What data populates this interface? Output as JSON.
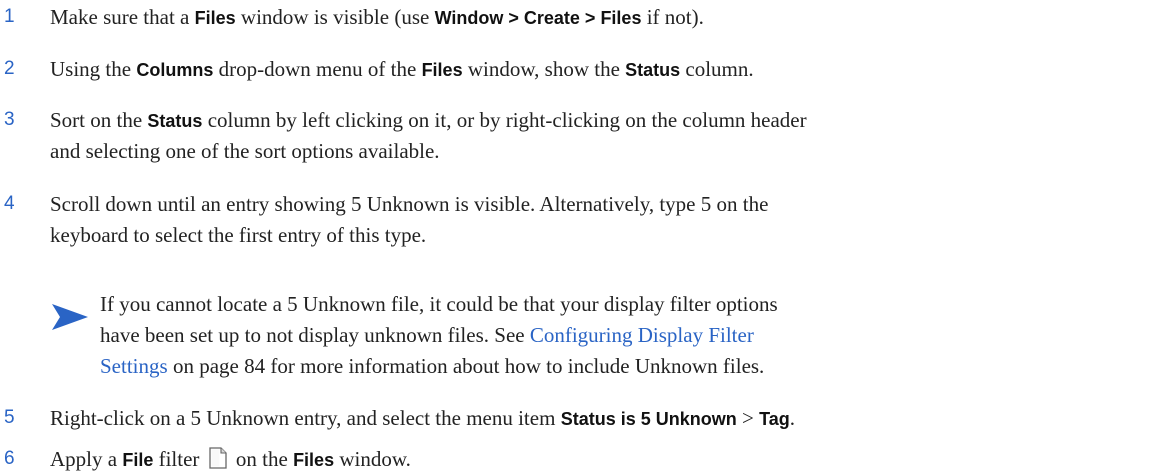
{
  "steps": [
    {
      "num": "1",
      "parts": [
        {
          "t": "Make sure that a "
        },
        {
          "b": "Files"
        },
        {
          "t": " window is visible (use "
        },
        {
          "b": "Window > Create > Files"
        },
        {
          "t": " if not)."
        }
      ]
    },
    {
      "num": "2",
      "parts": [
        {
          "t": "Using the "
        },
        {
          "b": "Columns"
        },
        {
          "t": " drop-down menu of the "
        },
        {
          "b": "Files"
        },
        {
          "t": " window, show the "
        },
        {
          "b": "Status"
        },
        {
          "t": " column."
        }
      ]
    },
    {
      "num": "3",
      "line1": [
        {
          "t": "Sort on the "
        },
        {
          "b": "Status"
        },
        {
          "t": " column by left clicking on it, or by right-clicking on the column header"
        }
      ],
      "line2": [
        {
          "t": "and selecting one of the sort options available."
        }
      ]
    },
    {
      "num": "4",
      "line1": [
        {
          "t": "Scroll down until an entry showing 5 Unknown is visible. Alternatively, type 5 on the"
        }
      ],
      "line2": [
        {
          "t": "keyboard to select the first entry of this type."
        }
      ]
    },
    {
      "num": "5",
      "parts": [
        {
          "t": "Right-click on a 5 Unknown entry, and select the menu item "
        },
        {
          "b": "Status is 5 Unknown"
        },
        {
          "t": " > "
        },
        {
          "b": "Tag"
        },
        {
          "t": "."
        }
      ]
    },
    {
      "num": "6",
      "before": [
        {
          "t": "Apply a "
        },
        {
          "b": "File"
        },
        {
          "t": " filter"
        }
      ],
      "after": [
        {
          "t": "on the "
        },
        {
          "b": "Files"
        },
        {
          "t": " window."
        }
      ]
    }
  ],
  "note": {
    "line1": "If you cannot locate a 5 Unknown file, it could be that your display filter options",
    "line2": "have been set up to not display unknown files. See ",
    "link1": "Configuring Display Filter",
    "line3_link": "Settings",
    "line3_rest": " on page 84 for more information about how to include Unknown files."
  },
  "colors": {
    "accent": "#2a64c5",
    "text": "#222222"
  },
  "icons": {
    "note": "note-arrow-icon",
    "file": "file-filter-icon"
  }
}
